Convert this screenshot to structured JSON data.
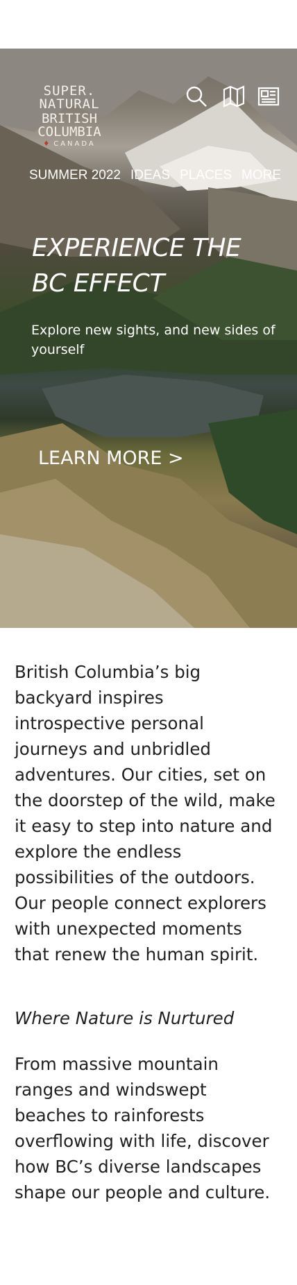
{
  "header": {
    "logo": {
      "line1": "SUPER. NATURAL",
      "line2": "BRITISH COLUMBIA",
      "line3": "CANADA"
    },
    "icons": [
      "search-icon",
      "map-icon",
      "newsletter-icon"
    ]
  },
  "nav": {
    "items": [
      {
        "label": "SUMMER 2022"
      },
      {
        "label": "IDEAS"
      },
      {
        "label": "PLACES"
      },
      {
        "label": "MORE"
      }
    ]
  },
  "hero": {
    "title": "EXPERIENCE THE BC EFFECT",
    "subtitle": "Explore new sights, and new sides of yourself",
    "cta": "LEARN MORE >"
  },
  "content": {
    "intro": "British Columbia’s big backyard inspires introspective personal journeys and unbridled adventures. Our cities, set on the doorstep of the wild, make it easy to step into nature and explore the endless possibilities of the outdoors. Our people connect explorers with unexpected moments that renew the human spirit.",
    "tagline": "Where Nature is Nurtured",
    "body": "From massive mountain ranges and windswept beaches to rainforests overflowing with life, discover how BC’s diverse landscapes shape our people and culture."
  },
  "colors": {
    "brand_leaf": "#c2362f",
    "text": "#1f1f1f",
    "hero_text": "#ffffff"
  }
}
